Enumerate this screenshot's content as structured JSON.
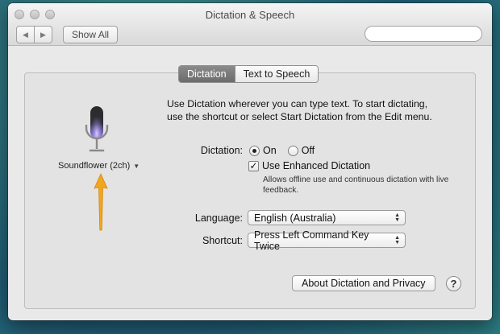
{
  "window": {
    "title": "Dictation & Speech"
  },
  "toolbar": {
    "back_icon": "◀",
    "forward_icon": "▶",
    "show_all_label": "Show All",
    "search_placeholder": ""
  },
  "tabs": [
    {
      "label": "Dictation",
      "active": true
    },
    {
      "label": "Text to Speech",
      "active": false
    }
  ],
  "mic": {
    "source_label": "Soundflower (2ch)",
    "source_dropdown_icon": "▼"
  },
  "description": "Use Dictation wherever you can type text. To start dictating, use the shortcut or select Start Dictation from the Edit menu.",
  "dictation": {
    "label": "Dictation:",
    "options": [
      {
        "label": "On",
        "selected": true
      },
      {
        "label": "Off",
        "selected": false
      }
    ]
  },
  "enhanced": {
    "label": "Use Enhanced Dictation",
    "checked": true,
    "check_glyph": "✓",
    "description": "Allows offline use and continuous dictation with live feedback."
  },
  "language": {
    "label": "Language:",
    "value": "English (Australia)"
  },
  "shortcut": {
    "label": "Shortcut:",
    "value": "Press Left Command Key Twice"
  },
  "stepper_glyphs": {
    "up": "▲",
    "down": "▼"
  },
  "buttons": {
    "about_label": "About Dictation and Privacy",
    "help_label": "?"
  },
  "colors": {
    "arrow": "#f2a51d",
    "mic_glow": "#9f8cff",
    "active_tab": "#7a7a7a"
  }
}
